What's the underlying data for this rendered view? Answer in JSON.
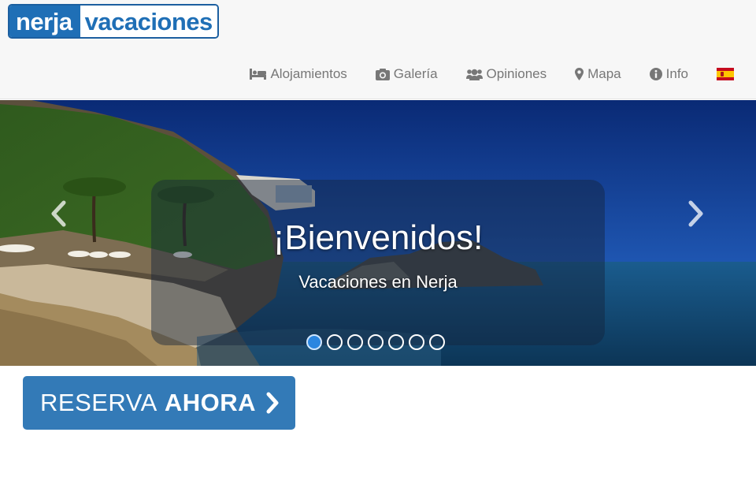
{
  "logo": {
    "left": "nerja",
    "right": "vacaciones"
  },
  "nav": {
    "items": [
      {
        "label": "Alojamientos",
        "icon": "bed-icon"
      },
      {
        "label": "Galería",
        "icon": "camera-icon"
      },
      {
        "label": "Opiniones",
        "icon": "users-icon"
      },
      {
        "label": "Mapa",
        "icon": "map-marker-icon"
      },
      {
        "label": "Info",
        "icon": "info-circle-icon"
      }
    ],
    "language_flag": "spain-flag-icon"
  },
  "carousel": {
    "title": "¡Bienvenidos!",
    "subtitle": "Vacaciones en Nerja",
    "slide_count": 7,
    "active_slide": 1
  },
  "cta": {
    "part1": "RESERVA",
    "part2": "AHORA"
  },
  "colors": {
    "brand_blue": "#1f6fb6",
    "button_blue": "#337ab7",
    "nav_text": "#777777",
    "active_dot": "#2b86e0"
  }
}
